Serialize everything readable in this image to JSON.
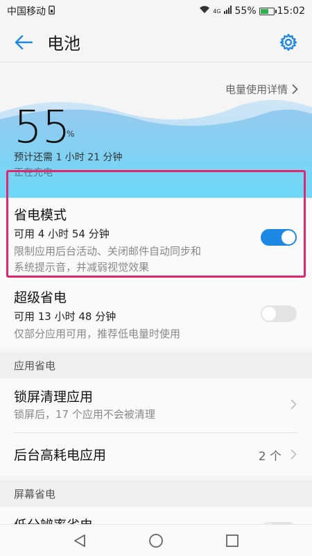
{
  "status_bar": {
    "carrier": "中国移动",
    "network": "4G",
    "battery_pct": "55%",
    "time": "15:02"
  },
  "app_bar": {
    "title": "电池",
    "back_icon": "back-arrow-icon",
    "settings_icon": "gear-icon"
  },
  "battery": {
    "detail_link": "电量使用详情",
    "level": "55",
    "level_unit": "%",
    "estimate": "预计还需 1 小时 21 分钟",
    "status": "正在充电"
  },
  "power_saving": {
    "title": "省电模式",
    "available": "可用 4 小时 54 分钟",
    "desc_line1": "限制应用后台活动、关闭邮件自动同步和",
    "desc_line2": "系统提示音，并减弱视觉效果",
    "enabled": true
  },
  "ultra_saving": {
    "title": "超级省电",
    "available": "可用 13 小时 48 分钟",
    "desc": "仅部分应用可用，推荐低电量时使用",
    "enabled": false
  },
  "app_saving_section": {
    "header": "应用省电",
    "lockscreen_title": "锁屏清理应用",
    "lockscreen_desc": "锁屏后，17 个应用不会被清理",
    "high_drain_title": "后台高耗电应用",
    "high_drain_count": "2 个"
  },
  "screen_saving_section": {
    "header": "屏幕省电",
    "low_res_title": "低分辨率省电"
  },
  "colors": {
    "accent": "#1e88e5",
    "highlight": "#e2256d",
    "wave_top": "#7ec3ef",
    "wave_bottom": "#67d9f8"
  }
}
